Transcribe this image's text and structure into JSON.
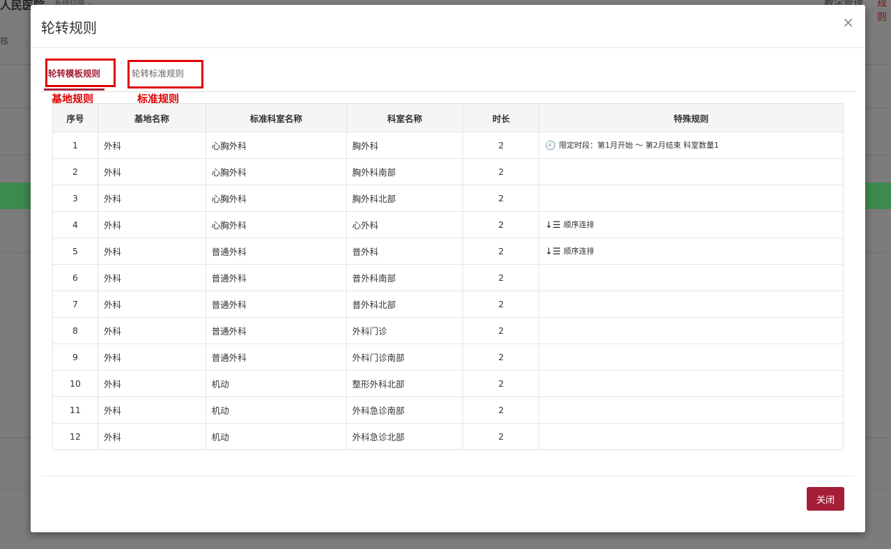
{
  "background": {
    "title": "人民医院",
    "switch_label": "系统切换 ⌄",
    "nav_right_1": "教学管理",
    "nav_right_2": "规则",
    "side_text": "核"
  },
  "modal": {
    "title": "轮转规则",
    "close_icon": "×",
    "tabs": [
      {
        "label": "轮转模板规则",
        "active": true
      },
      {
        "label": "轮转标准规则",
        "active": false
      }
    ],
    "annotations": [
      "基地规则",
      "标准规则"
    ],
    "table": {
      "headers": [
        "序号",
        "基地名称",
        "标准科室名称",
        "科室名称",
        "时长",
        "特殊规则"
      ],
      "rows": [
        {
          "no": "1",
          "base": "外科",
          "std_dept": "心胸外科",
          "dept": "胸外科",
          "duration": "2",
          "rule_icon": "clock-icon",
          "rule_glyph": "🕘",
          "rule": "限定时段：第1月开始 ～ 第2月结束 科室数量1"
        },
        {
          "no": "2",
          "base": "外科",
          "std_dept": "心胸外科",
          "dept": "胸外科南部",
          "duration": "2",
          "rule_icon": "",
          "rule_glyph": "",
          "rule": ""
        },
        {
          "no": "3",
          "base": "外科",
          "std_dept": "心胸外科",
          "dept": "胸外科北部",
          "duration": "2",
          "rule_icon": "",
          "rule_glyph": "",
          "rule": ""
        },
        {
          "no": "4",
          "base": "外科",
          "std_dept": "心胸外科",
          "dept": "心外科",
          "duration": "2",
          "rule_icon": "sort-order-icon",
          "rule_glyph": "↓☰",
          "rule": "顺序连排"
        },
        {
          "no": "5",
          "base": "外科",
          "std_dept": "普通外科",
          "dept": "普外科",
          "duration": "2",
          "rule_icon": "sort-order-icon",
          "rule_glyph": "↓☰",
          "rule": "顺序连排"
        },
        {
          "no": "6",
          "base": "外科",
          "std_dept": "普通外科",
          "dept": "普外科南部",
          "duration": "2",
          "rule_icon": "",
          "rule_glyph": "",
          "rule": ""
        },
        {
          "no": "7",
          "base": "外科",
          "std_dept": "普通外科",
          "dept": "普外科北部",
          "duration": "2",
          "rule_icon": "",
          "rule_glyph": "",
          "rule": ""
        },
        {
          "no": "8",
          "base": "外科",
          "std_dept": "普通外科",
          "dept": "外科门诊",
          "duration": "2",
          "rule_icon": "",
          "rule_glyph": "",
          "rule": ""
        },
        {
          "no": "9",
          "base": "外科",
          "std_dept": "普通外科",
          "dept": "外科门诊南部",
          "duration": "2",
          "rule_icon": "",
          "rule_glyph": "",
          "rule": ""
        },
        {
          "no": "10",
          "base": "外科",
          "std_dept": "机动",
          "dept": "整形外科北部",
          "duration": "2",
          "rule_icon": "",
          "rule_glyph": "",
          "rule": ""
        },
        {
          "no": "11",
          "base": "外科",
          "std_dept": "机动",
          "dept": "外科急诊南部",
          "duration": "2",
          "rule_icon": "",
          "rule_glyph": "",
          "rule": ""
        },
        {
          "no": "12",
          "base": "外科",
          "std_dept": "机动",
          "dept": "外科急诊北部",
          "duration": "2",
          "rule_icon": "",
          "rule_glyph": "",
          "rule": ""
        }
      ]
    },
    "close_button": "关闭"
  },
  "colors": {
    "accent": "#a61d37",
    "annotation_red": "#e00000",
    "overlay": "#7c7c7c"
  }
}
